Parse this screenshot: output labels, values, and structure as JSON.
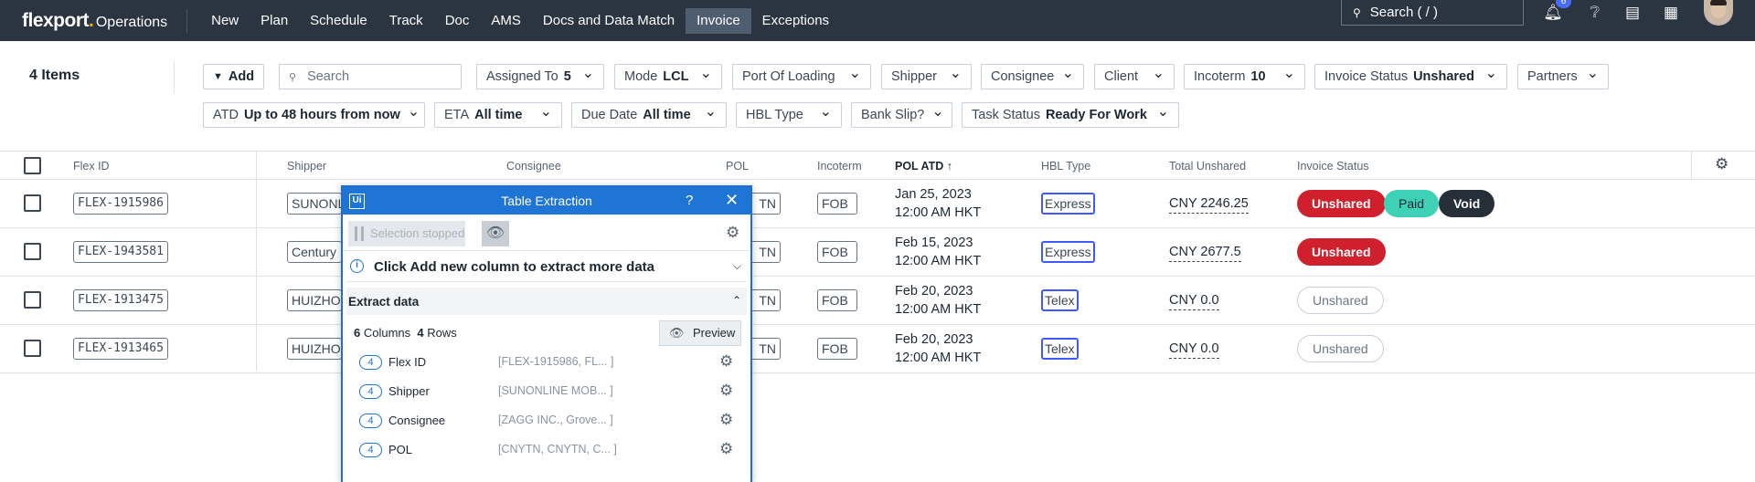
{
  "topnav": {
    "brand": "flexport",
    "product": "Operations",
    "items": [
      "New",
      "Plan",
      "Schedule",
      "Track",
      "Doc",
      "AMS",
      "Docs and Data Match",
      "Invoice",
      "Exceptions"
    ],
    "active": "Invoice",
    "search_label": "Search ( / )",
    "notification_count": "6"
  },
  "toolbar": {
    "items_count": "4 Items",
    "add_label": "Add",
    "search_placeholder": "Search",
    "filters_row1": [
      {
        "label": "Assigned To",
        "value": "5"
      },
      {
        "label": "Mode",
        "value": "LCL"
      },
      {
        "label": "Port Of Loading",
        "value": ""
      },
      {
        "label": "Shipper",
        "value": ""
      },
      {
        "label": "Consignee",
        "value": ""
      },
      {
        "label": "Client",
        "value": ""
      },
      {
        "label": "Incoterm",
        "value": "10"
      },
      {
        "label": "Invoice Status",
        "value": "Unshared"
      },
      {
        "label": "Partners",
        "value": ""
      }
    ],
    "filters_row2": [
      {
        "label": "ATD",
        "value": "Up to 48 hours from now"
      },
      {
        "label": "ETA",
        "value": "All time"
      },
      {
        "label": "Due Date",
        "value": "All time"
      },
      {
        "label": "HBL Type",
        "value": ""
      },
      {
        "label": "Bank Slip?",
        "value": ""
      },
      {
        "label": "Task Status",
        "value": "Ready For Work"
      }
    ]
  },
  "table": {
    "columns": [
      "Flex ID",
      "Shipper",
      "Consignee",
      "POL",
      "Incoterm",
      "POL ATD",
      "HBL Type",
      "Total Unshared",
      "Invoice Status"
    ],
    "sorted_indicator": "↑",
    "rows": [
      {
        "flex_id": "FLEX-1915986",
        "shipper": "SUNONL",
        "pol": "TN",
        "incoterm": "FOB",
        "atd_date": "Jan 25, 2023",
        "atd_time": "12:00 AM HKT",
        "hbl": "Express",
        "total": "CNY 2246.25",
        "statuses": [
          "Unshared",
          "Paid",
          "Void"
        ]
      },
      {
        "flex_id": "FLEX-1943581",
        "shipper": "Century I",
        "pol": "TN",
        "incoterm": "FOB",
        "atd_date": "Feb 15, 2023",
        "atd_time": "12:00 AM HKT",
        "hbl": "Express",
        "total": "CNY 2677.5",
        "statuses": [
          "Unshared"
        ]
      },
      {
        "flex_id": "FLEX-1913475",
        "shipper": "HUIZHOU",
        "pol": "TN",
        "incoterm": "FOB",
        "atd_date": "Feb 20, 2023",
        "atd_time": "12:00 AM HKT",
        "hbl": "Telex",
        "total": "CNY 0.0",
        "statuses": [
          "Unshared"
        ]
      },
      {
        "flex_id": "FLEX-1913465",
        "shipper": "HUIZHOU",
        "pol": "TN",
        "incoterm": "FOB",
        "atd_date": "Feb 20, 2023",
        "atd_time": "12:00 AM HKT",
        "hbl": "Telex",
        "total": "CNY 0.0",
        "statuses": [
          "Unshared"
        ]
      }
    ]
  },
  "extraction": {
    "logo": "Ui",
    "title": "Table Extraction",
    "help": "?",
    "close": "✕",
    "selection_status": "Selection stopped",
    "info_text": "Click Add new column to extract more data",
    "section_title": "Extract data",
    "columns_count": "6",
    "columns_label": "Columns",
    "rows_count": "4",
    "rows_label": "Rows",
    "preview_label": "Preview",
    "columns": [
      {
        "count": "4",
        "name": "Flex ID",
        "preview": "[FLEX-1915986, FL... ]"
      },
      {
        "count": "4",
        "name": "Shipper",
        "preview": "[SUNONLINE MOB... ]"
      },
      {
        "count": "4",
        "name": "Consignee",
        "preview": "[ZAGG INC., Grove... ]"
      },
      {
        "count": "4",
        "name": "POL",
        "preview": "[CNYTN, CNYTN, C... ]"
      }
    ]
  },
  "colors": {
    "topbar": "#2b3441",
    "accent": "#1f75d5",
    "unshared": "#d0202e",
    "paid": "#3ed1b8",
    "void": "#262e38",
    "hbl_border": "#4059ff"
  }
}
